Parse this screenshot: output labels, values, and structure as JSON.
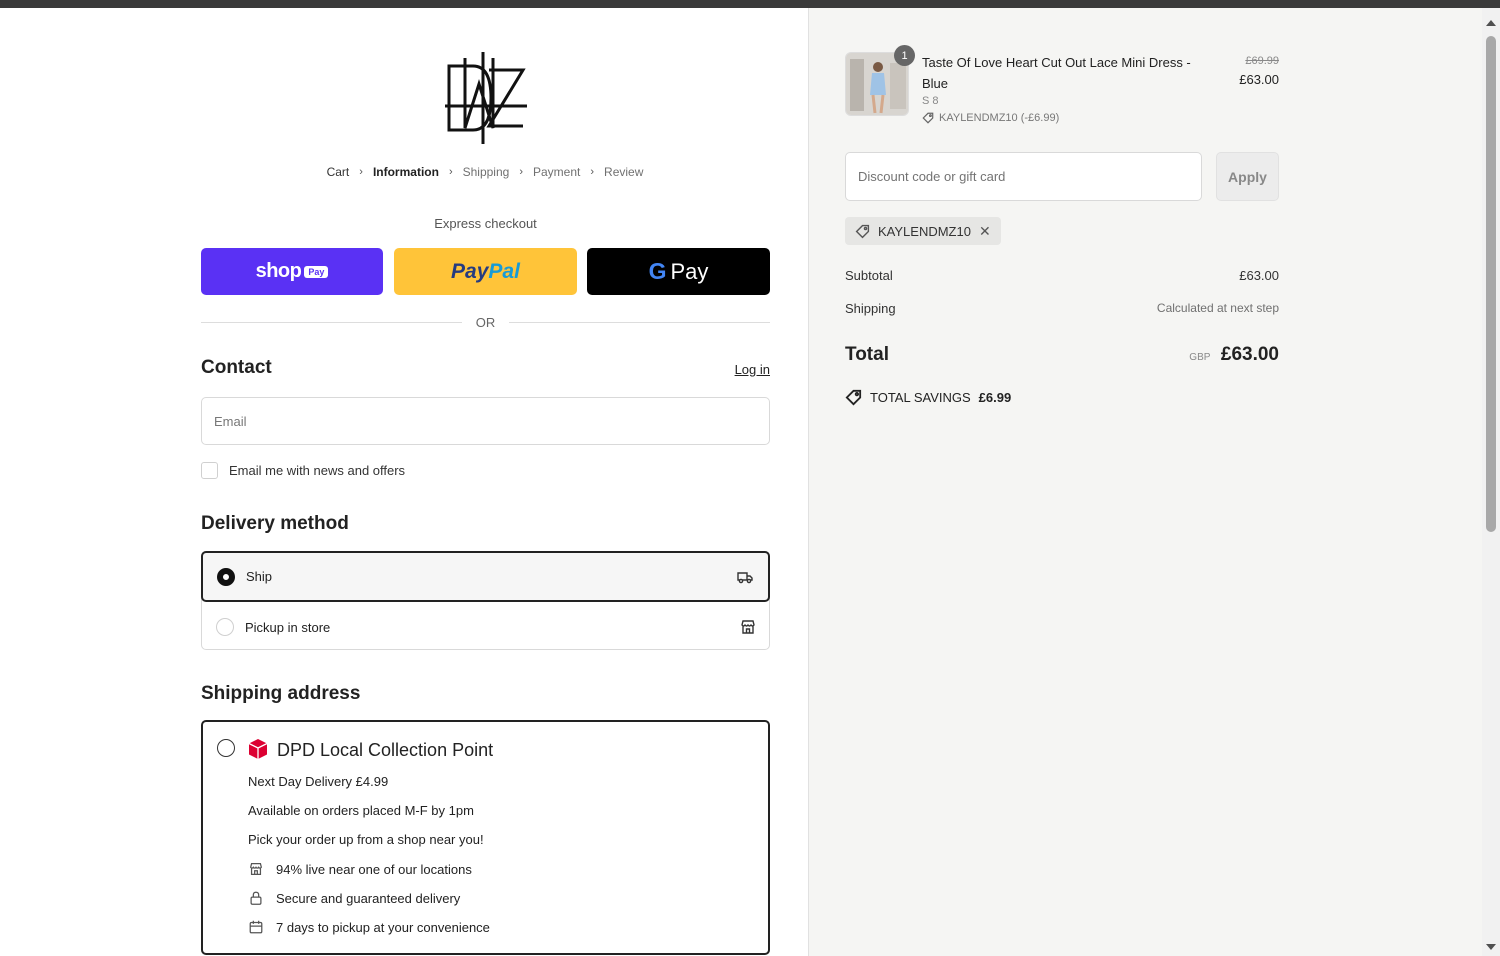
{
  "breadcrumb": {
    "cart": "Cart",
    "information": "Information",
    "shipping": "Shipping",
    "payment": "Payment",
    "review": "Review"
  },
  "express": {
    "label": "Express checkout",
    "shop_pay_word": "shop",
    "shop_pay_pill": "Pay",
    "paypal_part1": "Pay",
    "paypal_part2": "Pal",
    "gpay_g": "G",
    "gpay_word": "Pay",
    "or": "OR"
  },
  "contact": {
    "title": "Contact",
    "login": "Log in",
    "email_placeholder": "Email",
    "newsletter_label": "Email me with news and offers"
  },
  "delivery": {
    "title": "Delivery method",
    "options": [
      {
        "label": "Ship",
        "selected": true,
        "icon": "truck-icon"
      },
      {
        "label": "Pickup in store",
        "selected": false,
        "icon": "store-icon"
      }
    ]
  },
  "shipping_address": {
    "title": "Shipping address",
    "dpd": {
      "title": "DPD Local Collection Point",
      "lines": [
        "Next Day Delivery £4.99",
        "Available on orders placed M-F by 1pm",
        "Pick your order up from a shop near you!"
      ],
      "features": [
        {
          "icon": "store-icon",
          "text": "94% live near one of our locations"
        },
        {
          "icon": "lock-icon",
          "text": "Secure and guaranteed delivery"
        },
        {
          "icon": "calendar-icon",
          "text": "7 days to pickup at your convenience"
        }
      ],
      "brand_color": "#dc0032"
    }
  },
  "order": {
    "product": {
      "quantity": "1",
      "name": "Taste Of Love Heart Cut Out Lace Mini Dress - Blue",
      "variant": "S 8",
      "discount_note": "KAYLENDMZ10 (-£6.99)",
      "price_old": "£69.99",
      "price_new": "£63.00"
    },
    "discount_placeholder": "Discount code or gift card",
    "apply_label": "Apply",
    "applied_code": "KAYLENDMZ10",
    "subtotal_label": "Subtotal",
    "subtotal_value": "£63.00",
    "shipping_label": "Shipping",
    "shipping_value": "Calculated at next step",
    "total_label": "Total",
    "total_currency": "GBP",
    "total_value": "£63.00",
    "savings_label": "TOTAL SAVINGS",
    "savings_value": "£6.99"
  },
  "colors": {
    "shop_pay": "#5a31f4",
    "paypal": "#ffc439",
    "gpay": "#000000",
    "sidebar_bg": "#f5f5f3"
  }
}
